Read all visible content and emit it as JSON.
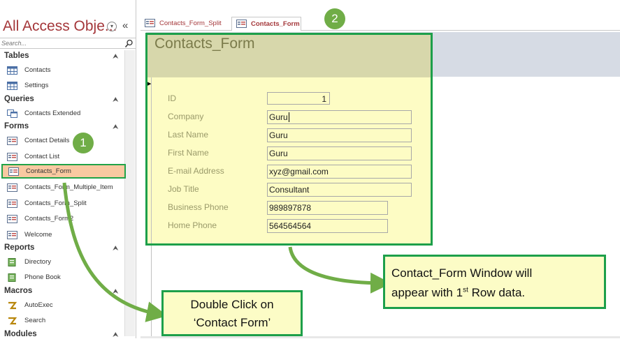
{
  "nav": {
    "title": "All Access Obje...",
    "dropdown_glyph": "▾",
    "collapse_glyph": "«",
    "search_placeholder": "Search...",
    "groups": [
      {
        "label": "Tables",
        "chevron": "⮝",
        "items": [
          {
            "label": "Contacts",
            "icon": "table-icon"
          },
          {
            "label": "Settings",
            "icon": "table-icon"
          }
        ]
      },
      {
        "label": "Queries",
        "chevron": "⮝",
        "items": [
          {
            "label": "Contacts Extended",
            "icon": "query-icon"
          }
        ]
      },
      {
        "label": "Forms",
        "chevron": "⮝",
        "items": [
          {
            "label": "Contact Details",
            "icon": "form-icon"
          },
          {
            "label": "Contact List",
            "icon": "form-icon"
          },
          {
            "label": "Contacts_Form",
            "icon": "form-icon",
            "selected": true
          },
          {
            "label": "Contacts_Form_Multiple_Item",
            "icon": "form-icon"
          },
          {
            "label": "Contacts_Form_Split",
            "icon": "form-icon"
          },
          {
            "label": "Contacts_Form2",
            "icon": "form-icon"
          },
          {
            "label": "Welcome",
            "icon": "form-icon"
          }
        ]
      },
      {
        "label": "Reports",
        "chevron": "⮝",
        "items": [
          {
            "label": "Directory",
            "icon": "report-icon"
          },
          {
            "label": "Phone Book",
            "icon": "report-icon"
          }
        ]
      },
      {
        "label": "Macros",
        "chevron": "⮝",
        "items": [
          {
            "label": "AutoExec",
            "icon": "macro-icon"
          },
          {
            "label": "Search",
            "icon": "macro-icon"
          }
        ]
      },
      {
        "label": "Modules",
        "chevron": "⮝",
        "items": []
      }
    ]
  },
  "tabs": [
    {
      "label": "Contacts_Form_Split",
      "active": false
    },
    {
      "label": "Contacts_Form",
      "active": true
    }
  ],
  "form": {
    "title": "Contacts_Form",
    "record_marker": "▶",
    "fields": [
      {
        "label": "ID",
        "value": "1"
      },
      {
        "label": "Company",
        "value": "Guru"
      },
      {
        "label": "Last Name",
        "value": "Guru"
      },
      {
        "label": "First Name",
        "value": "Guru"
      },
      {
        "label": "E-mail Address",
        "value": "xyz@gmail.com"
      },
      {
        "label": "Job Title",
        "value": "Consultant"
      },
      {
        "label": "Business Phone",
        "value": "989897878"
      },
      {
        "label": "Home Phone",
        "value": "564564564"
      }
    ]
  },
  "annotations": {
    "badge1": "1",
    "badge2": "2",
    "callout_left_line1": "Double Click on",
    "callout_left_line2": "‘Contact Form’",
    "callout_right_line1": "Contact_Form Window will",
    "callout_right_line2_pre": "appear with 1",
    "callout_right_line2_sup": "st",
    "callout_right_line2_post": " Row data."
  },
  "colors": {
    "title_red": "#a4373a",
    "annotation_green": "#1d9f4a",
    "badge_green": "#70ad47",
    "selected_bg": "#f9c9a1",
    "form_yellow": "#fdfcc4",
    "callout_yellow": "#fcfcc6"
  }
}
